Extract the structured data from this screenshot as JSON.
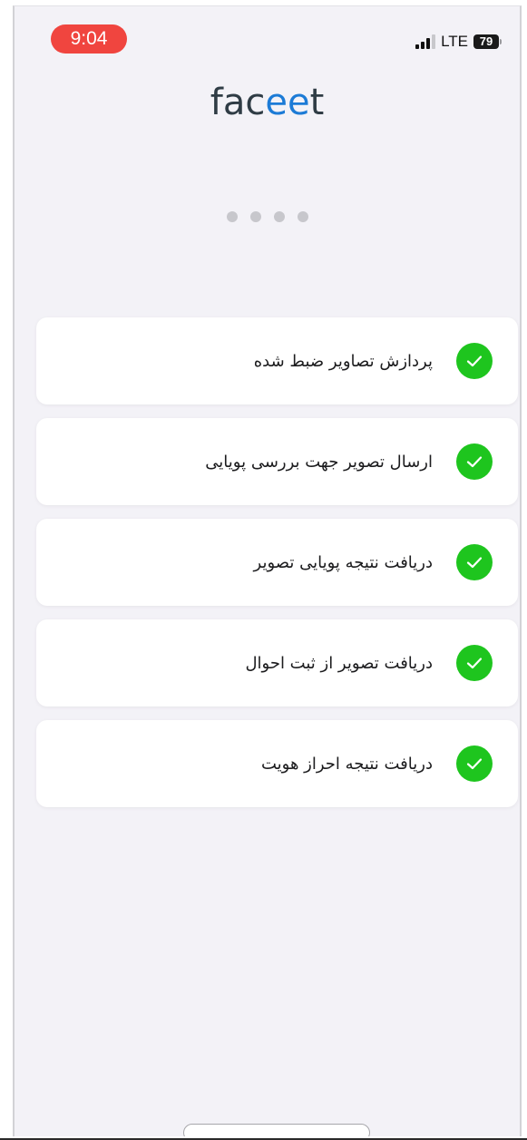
{
  "status_bar": {
    "time": "9:04",
    "network": "LTE",
    "battery": "79",
    "accent_color": "#f0453f"
  },
  "logo": {
    "part1": "fac",
    "part2": "ee",
    "part3": "t",
    "dark_color": "#2f3c45",
    "blue_color": "#1c7bd6"
  },
  "pager": {
    "dot_count": 4
  },
  "steps": [
    {
      "label": "پردازش تصاویر ضبط شده",
      "status": "complete",
      "icon": "check-icon"
    },
    {
      "label": "ارسال تصویر جهت بررسی پویایی",
      "status": "complete",
      "icon": "check-icon"
    },
    {
      "label": "دریافت نتیجه پویایی تصویر",
      "status": "complete",
      "icon": "check-icon"
    },
    {
      "label": "دریافت تصویر از ثبت احوال",
      "status": "complete",
      "icon": "check-icon"
    },
    {
      "label": "دریافت نتیجه احراز هویت",
      "status": "complete",
      "icon": "check-icon"
    }
  ],
  "colors": {
    "success": "#1ec51e",
    "background": "#f3f2f7",
    "card": "#ffffff"
  }
}
